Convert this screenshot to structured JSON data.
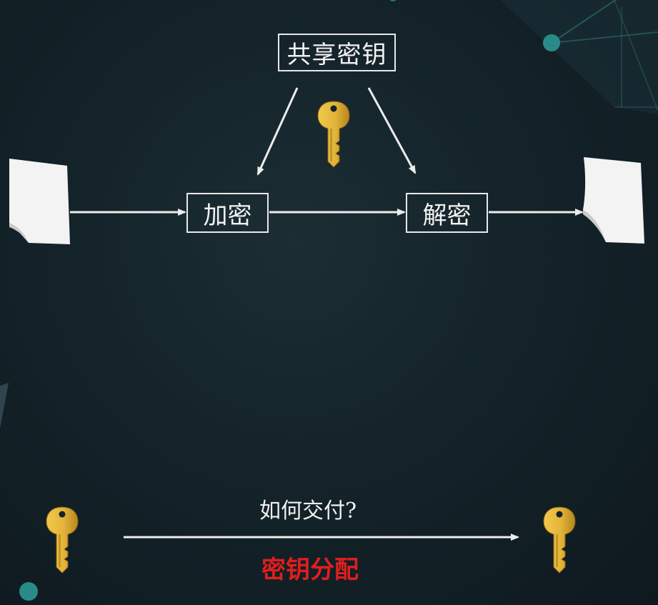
{
  "diagram": {
    "shared_key_label": "共享密钥",
    "encrypt_label": "加密",
    "decrypt_label": "解密",
    "question_label": "如何交付?",
    "distribution_label": "密钥分配"
  },
  "colors": {
    "background": "#14232a",
    "line": "#ececec",
    "key_gold": "#e2b43a",
    "key_gold_dark": "#b5861c",
    "highlight_red": "#e01e1e",
    "paper": "#f3f3f3"
  },
  "icons": {
    "key": "key-icon",
    "document": "paper-document-icon"
  }
}
